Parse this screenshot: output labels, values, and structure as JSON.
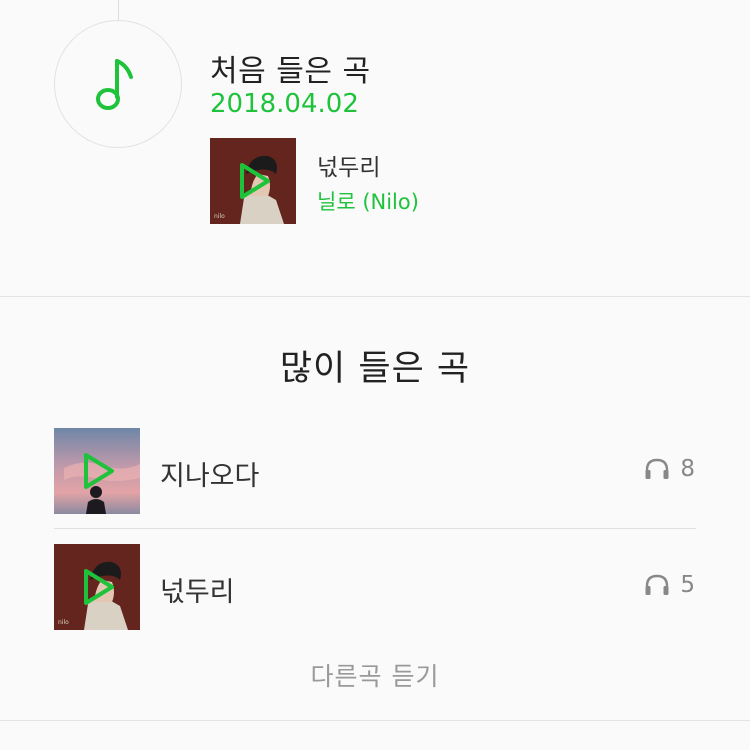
{
  "first_played": {
    "title": "처음 들은 곡",
    "date": "2018.04.02",
    "song": {
      "title": "넋두리",
      "artist": "닐로 (Nilo)",
      "icon": "play-icon"
    }
  },
  "most_played": {
    "title": "많이 들은 곡",
    "items": [
      {
        "title": "지나오다",
        "play_count": "8",
        "icon": "headphones-icon"
      },
      {
        "title": "넋두리",
        "play_count": "5",
        "icon": "headphones-icon"
      }
    ],
    "more_label": "다른곡 듣기"
  },
  "colors": {
    "accent": "#1ec33b",
    "text": "#222222",
    "muted": "#999999"
  }
}
